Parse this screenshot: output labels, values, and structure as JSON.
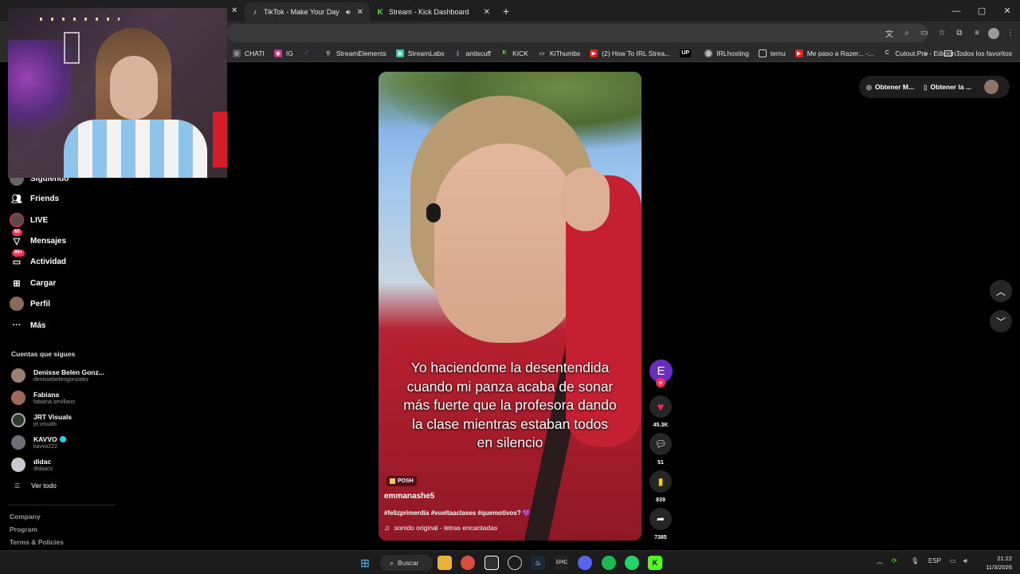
{
  "browser": {
    "tabs": [
      {
        "label": "TikTok - Make Your Day",
        "active": true
      },
      {
        "label": "Stream - Kick Dashboard",
        "active": false
      }
    ],
    "new_tab_icon": "plus-icon",
    "window_controls": {
      "minimize": "—",
      "maximize": "▢",
      "close": "✕"
    }
  },
  "bookmarks": {
    "items": [
      "CHATI",
      "IG",
      "",
      "StreamElements",
      "StreamLabs",
      "antiscuff",
      "KICK",
      "KiThumbs",
      "(2) How To IRL Strea...",
      "UP",
      "IRLhosting",
      "temu",
      "Me paso a Razer... -...",
      "Cutout.Pro - Edición..."
    ],
    "all_favorites": "Todos los favoritos"
  },
  "sidebar": {
    "items": [
      {
        "label": "Siguiendo",
        "icon": "following-avatar-icon",
        "badge": ""
      },
      {
        "label": "Friends",
        "icon": "friends-icon",
        "badge": ""
      },
      {
        "label": "LIVE",
        "icon": "live-icon",
        "badge": ""
      },
      {
        "label": "Mensajes",
        "icon": "messages-icon",
        "badge": "60"
      },
      {
        "label": "Actividad",
        "icon": "activity-icon",
        "badge": "99+"
      },
      {
        "label": "Cargar",
        "icon": "upload-icon",
        "badge": ""
      },
      {
        "label": "Perfil",
        "icon": "profile-avatar-icon",
        "badge": ""
      },
      {
        "label": "Más",
        "icon": "more-icon",
        "badge": ""
      }
    ],
    "following_title": "Cuentas que sigues",
    "accounts": [
      {
        "name": "Denisse Belen Gonz...",
        "handle": "denissebelengonzalez",
        "verified": false
      },
      {
        "name": "Fabiana",
        "handle": "fabiana.sevillano",
        "verified": false
      },
      {
        "name": "JRT Visuals",
        "handle": "jrt.visuals",
        "verified": false
      },
      {
        "name": "KAVVO",
        "handle": "kavvo222",
        "verified": true
      },
      {
        "name": "didac",
        "handle": "didaacs",
        "verified": false
      }
    ],
    "see_all": "Ver todo",
    "footer": [
      "Company",
      "Program",
      "Terms & Policies"
    ]
  },
  "top_pill": {
    "btn1": "Obtener M...",
    "btn2": "Obtener la ..."
  },
  "video": {
    "caption": "Yo haciendome la desentendida cuando mi panza acaba de sonar más fuerte que la profesora dando la clase mientras estaban todos en silencio",
    "badge": "POSH",
    "username": "emmanashe5",
    "hashtags": "#felizprimerdia #vueltaaclases #quemotivos? 💜",
    "sound": "sonido original - letras encantadas"
  },
  "actions": {
    "creator_initial": "E",
    "likes": "45.3K",
    "comments": "51",
    "saves": "839",
    "shares": "7385"
  },
  "taskbar": {
    "search": "Buscar",
    "lang": "ESP",
    "time": "21:22",
    "date": "11/3/2026"
  },
  "colors": {
    "tiktok_red": "#fe2c55",
    "kick_green": "#53fc18",
    "save_yellow": "#facd00"
  }
}
